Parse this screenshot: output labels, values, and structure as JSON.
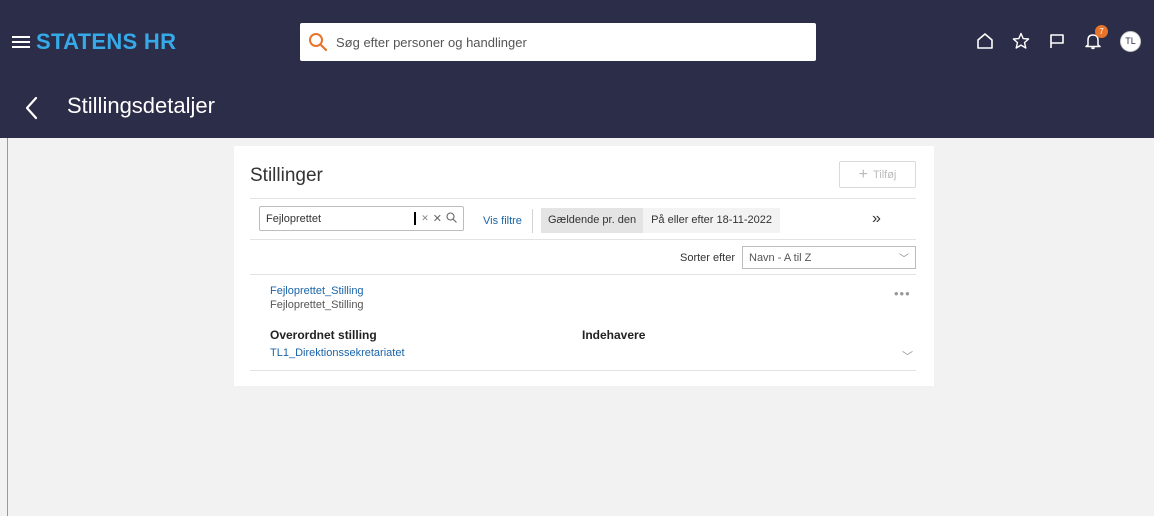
{
  "header": {
    "brand": "STATENS HR",
    "search_placeholder": "Søg efter personer og handlinger",
    "notification_count": "7",
    "avatar_initials": "TL"
  },
  "subheader": {
    "title": "Stillingsdetaljer"
  },
  "card": {
    "title": "Stillinger",
    "add_label": "Tilføj",
    "filter_value": "Fejloprettet",
    "vis_filtre": "Vis filtre",
    "date_label": "Gældende pr. den",
    "date_value": "På eller efter 18-11-2022",
    "sort_label": "Sorter efter",
    "sort_value": "Navn - A til Z",
    "item": {
      "title": "Fejloprettet_Stilling",
      "subtitle": "Fejloprettet_Stilling",
      "parent_label": "Overordnet stilling",
      "holders_label": "Indehavere",
      "parent_value": "TL1_Direktionssekretariatet"
    }
  },
  "colors": {
    "header_bg": "#2c2d48",
    "brand": "#36a9e8",
    "link": "#1a64a8",
    "badge": "#e8742a"
  }
}
